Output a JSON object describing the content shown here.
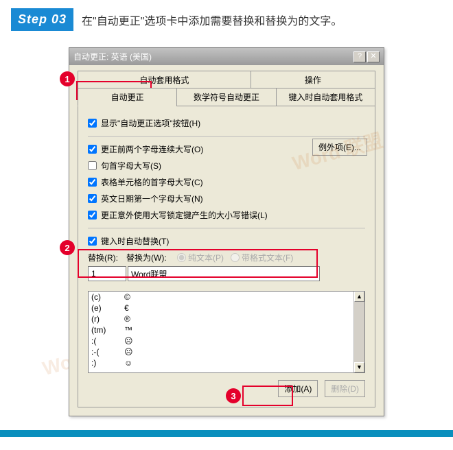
{
  "step": {
    "badge": "Step 03",
    "text": "在\"自动更正\"选项卡中添加需要替换和替换为的文字。"
  },
  "dialog": {
    "title": "自动更正: 英语 (美国)"
  },
  "tabs": {
    "row1": [
      "自动套用格式",
      "操作"
    ],
    "row2": [
      "自动更正",
      "数学符号自动更正",
      "键入时自动套用格式"
    ]
  },
  "checkboxes": {
    "show_options": "显示\"自动更正选项\"按钮(H)",
    "two_caps": "更正前两个字母连续大写(O)",
    "sentence_cap": "句首字母大写(S)",
    "table_cell_cap": "表格单元格的首字母大写(C)",
    "english_date": "英文日期第一个字母大写(N)",
    "capslock": "更正意外使用大写锁定键产生的大小写错误(L)",
    "replace_as_type": "键入时自动替换(T)"
  },
  "exceptions_btn": "例外项(E)...",
  "replace": {
    "replace_lbl": "替换(R):",
    "with_lbl": "替换为(W):",
    "replace_val": "1",
    "with_val": "Word联盟",
    "radio_plain": "纯文本(P)",
    "radio_formatted": "带格式文本(F)"
  },
  "dict": [
    {
      "k": "(c)",
      "v": "©"
    },
    {
      "k": "(e)",
      "v": "€"
    },
    {
      "k": "(r)",
      "v": "®"
    },
    {
      "k": "(tm)",
      "v": "™"
    },
    {
      "k": ":(",
      "v": "☹"
    },
    {
      "k": ":-(",
      "v": "☹"
    },
    {
      "k": ":)",
      "v": "☺"
    }
  ],
  "buttons": {
    "add": "添加(A)",
    "delete": "删除(D)"
  },
  "badges": {
    "b1": "1",
    "b2": "2",
    "b3": "3"
  },
  "watermark": "Word 联盟"
}
